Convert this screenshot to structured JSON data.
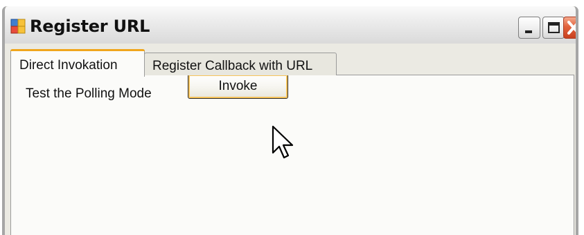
{
  "window": {
    "title": "Register URL",
    "icon": "app-form-icon",
    "controls": [
      "minimize-icon",
      "maximize-icon",
      "close-icon"
    ]
  },
  "tabs": [
    {
      "label": "Direct Invokation",
      "active": true
    },
    {
      "label": "Register Callback with URL",
      "active": false
    }
  ],
  "panel": {
    "polling_label": "Test the Polling Mode",
    "invoke_button": "Invoke"
  },
  "colors": {
    "tab_accent": "#f0a61c",
    "button_focus": "#f6c35a",
    "close_button": "#e2623c"
  }
}
